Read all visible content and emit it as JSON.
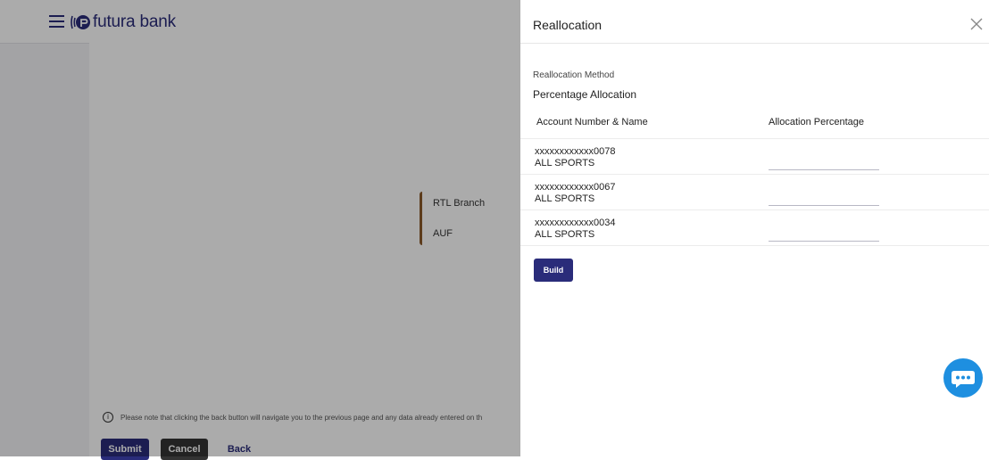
{
  "app": {
    "brand": "futura bank"
  },
  "background": {
    "branch_card": {
      "line1": "RTL Branch",
      "line2": "AUF"
    },
    "note": "Please note that clicking the back button will navigate you to the previous page and any data already entered on th",
    "buttons": {
      "submit": "Submit",
      "cancel": "Cancel",
      "back": "Back"
    }
  },
  "panel": {
    "title": "Reallocation",
    "method_label": "Reallocation Method",
    "method_value": "Percentage Allocation",
    "columns": {
      "account": "Account Number & Name",
      "percentage": "Allocation Percentage"
    },
    "rows": [
      {
        "account_number": "xxxxxxxxxxxx0078",
        "account_name": "ALL SPORTS",
        "percentage": ""
      },
      {
        "account_number": "xxxxxxxxxxxx0067",
        "account_name": "ALL SPORTS",
        "percentage": ""
      },
      {
        "account_number": "xxxxxxxxxxxx0034",
        "account_name": "ALL SPORTS",
        "percentage": ""
      }
    ],
    "build_label": "Build"
  },
  "icons": {
    "menu": "hamburger-icon",
    "close": "close-icon",
    "chat": "chat-icon",
    "info": "info-icon",
    "logo": "futura-logo"
  },
  "colors": {
    "brand": "#2a2c7a",
    "chat": "#1e8fe0",
    "card_accent": "#8b5a2b"
  }
}
